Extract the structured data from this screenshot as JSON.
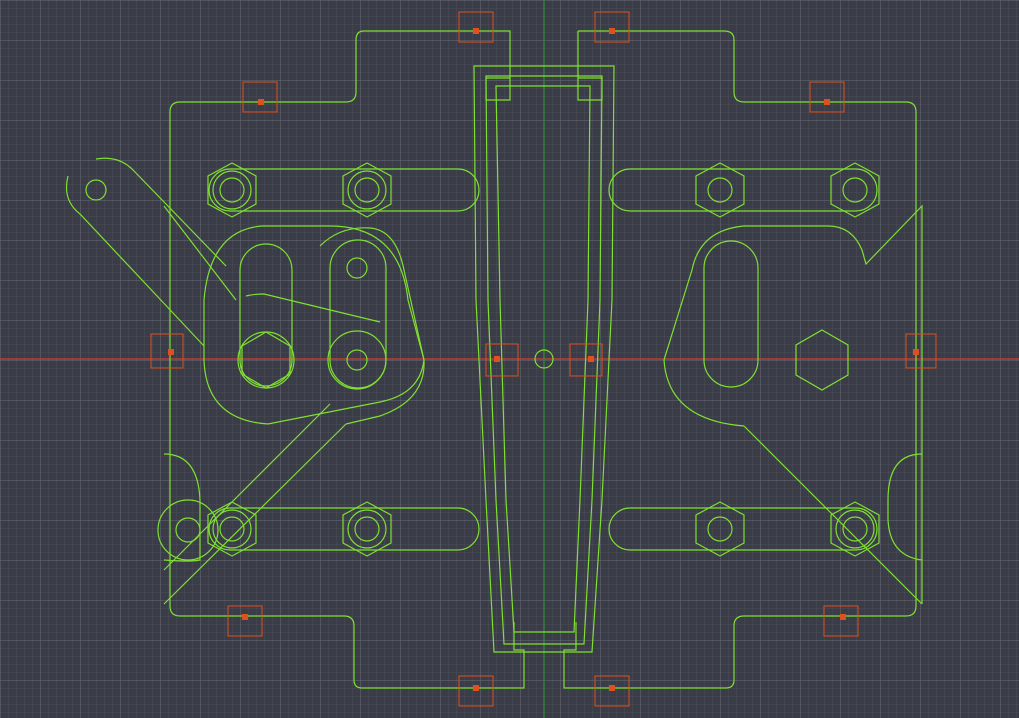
{
  "canvas": {
    "background_color": "#3a3c47",
    "grid_minor_color": "#575a66",
    "grid_major_color": "#6b6e7a",
    "horizontal_axis_color": "#d23c32",
    "vertical_axis_color": "#2f8f3a",
    "geometry_color": "#7fe030",
    "marker_color": "#e0501e"
  },
  "marker_icon": "square-snap-point-icon",
  "parts": [
    "outer-frame",
    "left-cutout-block",
    "right-cutout-block",
    "center-tapered-channel",
    "upper-left-slot",
    "upper-right-slot",
    "lower-left-slot",
    "lower-right-slot",
    "left-linkage-arm",
    "left-cam-plate",
    "right-cam-plate",
    "hex-nuts",
    "center-pin"
  ]
}
